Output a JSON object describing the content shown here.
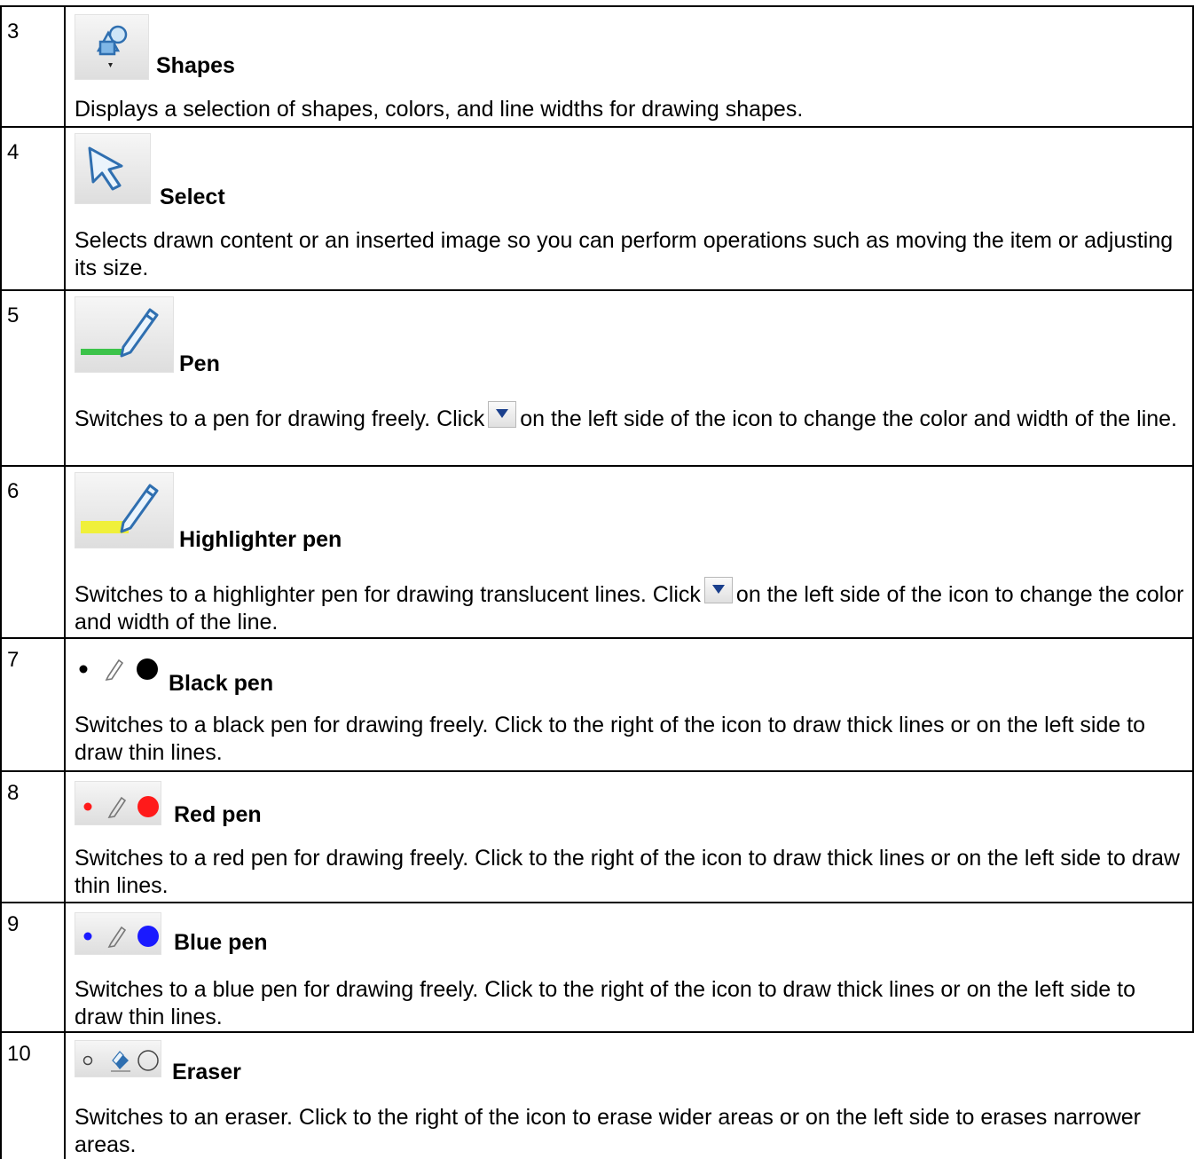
{
  "rows": [
    {
      "num": "3",
      "title": "Shapes",
      "desc": "Displays a selection of shapes, colors, and line widths for drawing shapes.",
      "icon": "shapes-icon"
    },
    {
      "num": "4",
      "title": "Select",
      "desc": "Selects drawn content or an inserted image so you can perform operations such as moving the item or adjusting its size.",
      "icon": "select-arrow-icon"
    },
    {
      "num": "5",
      "title": "Pen",
      "desc_a": "Switches to a pen for drawing freely. Click",
      "desc_b": "on the left side of the icon to change the color and width of the line.",
      "icon": "pen-icon"
    },
    {
      "num": "6",
      "title": "Highlighter pen",
      "desc_a": "Switches to a highlighter pen for drawing translucent lines. Click",
      "desc_b": "on the left side of the icon to change the color and width of the line.",
      "icon": "highlighter-icon"
    },
    {
      "num": "7",
      "title": "Black pen",
      "desc": "Switches to a black pen for drawing freely. Click to the right of the icon to draw thick lines or on the left side to draw thin lines.",
      "icon": "black-pen-icon",
      "color": "#000000"
    },
    {
      "num": "8",
      "title": "Red pen",
      "desc": "Switches to a red pen for drawing freely. Click to the right of the icon to draw thick lines or on the left side to draw thin lines.",
      "icon": "red-pen-icon",
      "color": "#ff1a1a"
    },
    {
      "num": "9",
      "title": "Blue pen",
      "desc": "Switches to a blue pen for drawing freely. Click to the right of the icon to draw thick lines or on the left side to draw thin lines.",
      "icon": "blue-pen-icon",
      "color": "#1a1aff"
    },
    {
      "num": "10",
      "title": "Eraser",
      "desc": "Switches to an eraser. Click to the right of the icon to erase wider areas or on the left side to erases narrower areas.",
      "icon": "eraser-icon"
    }
  ]
}
